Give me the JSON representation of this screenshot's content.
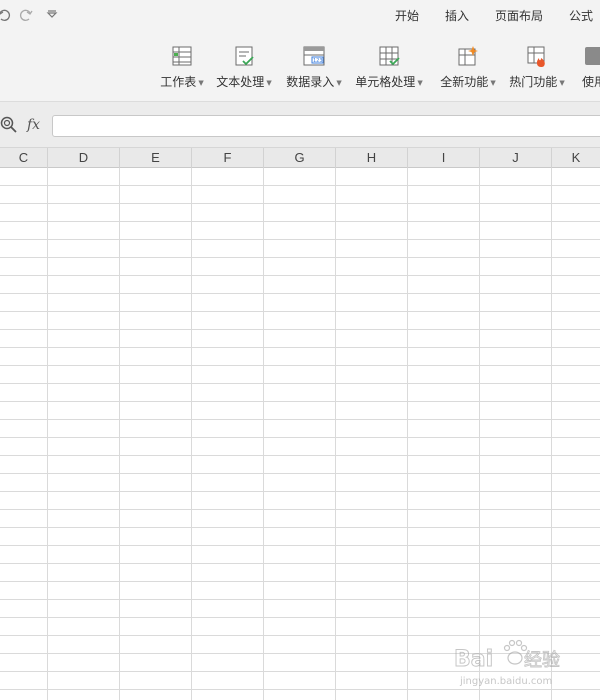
{
  "quick_access": {
    "undo_icon": "undo-icon",
    "redo_icon": "redo-icon",
    "customize_icon": "customize-dropdown-icon"
  },
  "menu": {
    "tabs": [
      "开始",
      "插入",
      "页面布局",
      "公式"
    ]
  },
  "ribbon": {
    "buttons": [
      {
        "label": "工作表",
        "icon": "worksheet-icon"
      },
      {
        "label": "文本处理",
        "icon": "text-process-icon"
      },
      {
        "label": "数据录入",
        "icon": "data-entry-icon"
      },
      {
        "label": "单元格处理",
        "icon": "cell-process-icon"
      },
      {
        "label": "全新功能",
        "icon": "new-features-icon"
      },
      {
        "label": "热门功能",
        "icon": "popular-features-icon"
      },
      {
        "label": "使用",
        "icon": "usage-icon"
      }
    ]
  },
  "formula_bar": {
    "fx_label": "fx",
    "value": ""
  },
  "columns": [
    "C",
    "D",
    "E",
    "F",
    "G",
    "H",
    "I",
    "J",
    "K"
  ],
  "watermark": {
    "brand": "Baidu",
    "suffix": "经验",
    "url": "jingyan.baidu.com"
  },
  "colors": {
    "toolbar_bg": "#f3f3f3",
    "header_bg": "#e9e9e9",
    "gridline": "#dadada"
  }
}
